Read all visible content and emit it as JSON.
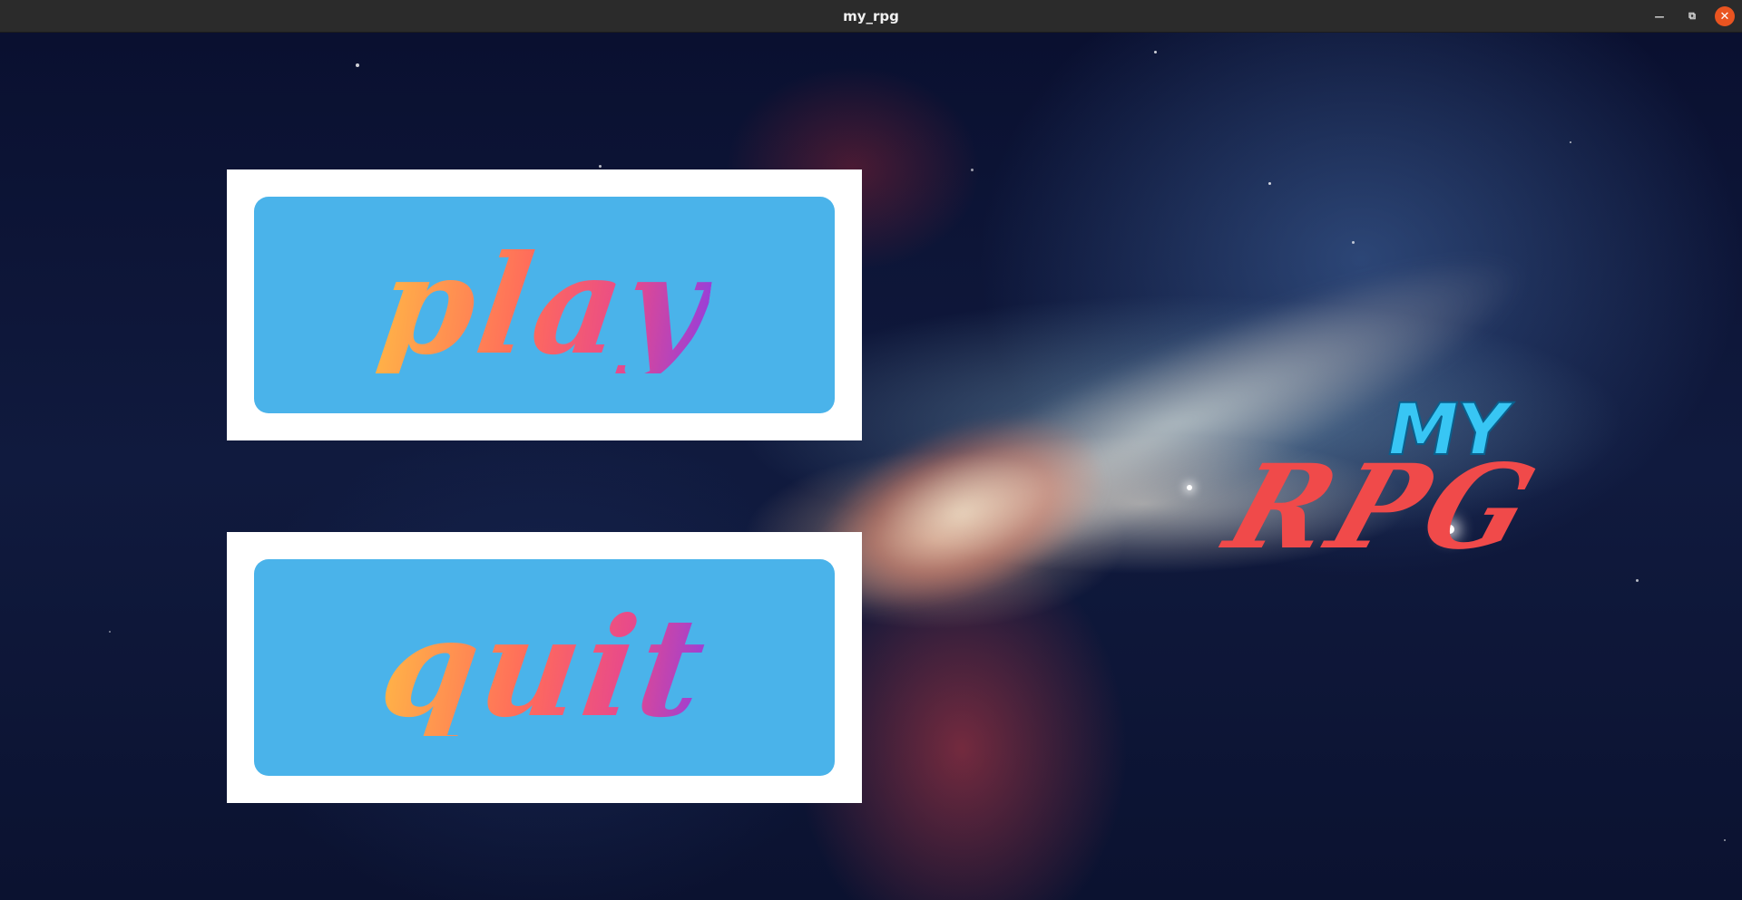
{
  "window": {
    "title": "my_rpg",
    "controls": {
      "minimize_icon": "minimize-icon",
      "maximize_icon": "maximize-icon",
      "close_icon": "close-icon"
    }
  },
  "menu": {
    "play_label": "play",
    "quit_label": "quit"
  },
  "logo": {
    "top_text": "MY",
    "main_text": "RPG"
  },
  "colors": {
    "button_frame": "#ffffff",
    "button_fill": "#4ab3ea",
    "logo_my": "#38c6f4",
    "logo_rpg": "#f04a4a",
    "titlebar": "#2b2b2b",
    "close_button": "#e95420"
  }
}
